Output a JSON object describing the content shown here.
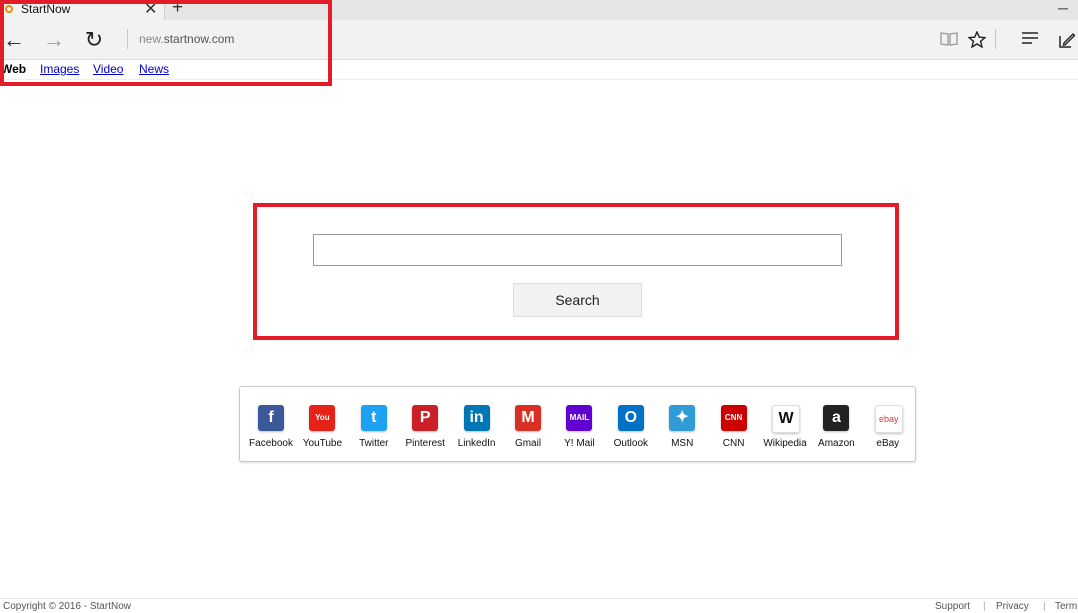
{
  "browser": {
    "tab_title": "StartNow",
    "tab_close": "✕",
    "new_tab": "+",
    "minimize": "─",
    "url_prefix": "new.",
    "url_host": "startnow.com"
  },
  "nav": {
    "back": "←",
    "forward": "→",
    "refresh": "↻"
  },
  "verticals": [
    {
      "label": "Web",
      "active": true
    },
    {
      "label": "Images",
      "active": false
    },
    {
      "label": "Video",
      "active": false
    },
    {
      "label": "News",
      "active": false
    }
  ],
  "search": {
    "value": "",
    "button_label": "Search"
  },
  "quick_links": [
    {
      "label": "Facebook",
      "glyph": "f",
      "color": "#3b5998",
      "icon": "facebook-icon"
    },
    {
      "label": "YouTube",
      "glyph": "You",
      "color": "#e62117",
      "icon": "youtube-icon"
    },
    {
      "label": "Twitter",
      "glyph": "t",
      "color": "#1da1f2",
      "icon": "twitter-icon"
    },
    {
      "label": "Pinterest",
      "glyph": "P",
      "color": "#cb2027",
      "icon": "pinterest-icon"
    },
    {
      "label": "LinkedIn",
      "glyph": "in",
      "color": "#0077b5",
      "icon": "linkedin-icon"
    },
    {
      "label": "Gmail",
      "glyph": "M",
      "color": "#d93025",
      "icon": "gmail-icon"
    },
    {
      "label": "Y! Mail",
      "glyph": "MAIL",
      "color": "#6001d2",
      "icon": "yahoo-mail-icon"
    },
    {
      "label": "Outlook",
      "glyph": "O",
      "color": "#0072c6",
      "icon": "outlook-icon"
    },
    {
      "label": "MSN",
      "glyph": "✦",
      "color": "#2f9bd7",
      "icon": "msn-icon"
    },
    {
      "label": "CNN",
      "glyph": "CNN",
      "color": "#cc0000",
      "icon": "cnn-icon"
    },
    {
      "label": "Wikipedia",
      "glyph": "W",
      "color": "#ffffff",
      "icon": "wikipedia-icon"
    },
    {
      "label": "Amazon",
      "glyph": "a",
      "color": "#222222",
      "icon": "amazon-icon"
    },
    {
      "label": "eBay",
      "glyph": "ebay",
      "color": "#ffffff",
      "icon": "ebay-icon"
    }
  ],
  "footer": {
    "copyright": "Copyright © 2016 - StartNow",
    "links": [
      "Support",
      "Privacy",
      "Term"
    ]
  },
  "colors": {
    "highlight": "#e21c28",
    "link": "#0000cc"
  }
}
